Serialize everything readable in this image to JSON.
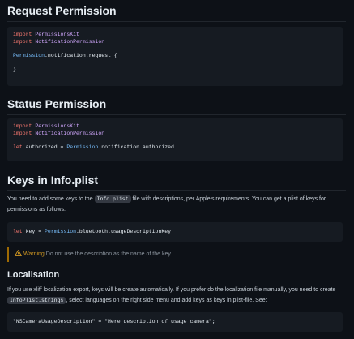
{
  "request": {
    "heading": "Request Permission",
    "import_kw": "import",
    "module1": "PermissionsKit",
    "module2": "NotificationPermission",
    "call": "Permission",
    "call_rest": ".notification.request {",
    "close_brace": "}"
  },
  "status": {
    "heading": "Status Permission",
    "import_kw": "import",
    "module1": "PermissionsKit",
    "module2": "NotificationPermission",
    "let_kw": "let",
    "var_name": "authorized",
    "assign": " = ",
    "call": "Permission",
    "call_rest": ".notification.authorized"
  },
  "keys": {
    "heading": "Keys in Info.plist",
    "para_before": "You need to add some keys to the ",
    "inline_code": "Info.plist",
    "para_after": " file with descriptions, per Apple's requirements. You can get a plist of keys for permissions as follows:",
    "code_let": "let",
    "code_var": "key",
    "code_assign": " = ",
    "code_call": "Permission",
    "code_rest": ".bluetooth.usageDescriptionKey",
    "warning_title": "Warning",
    "warning_text": " Do not use the description as the name of the key."
  },
  "localisation": {
    "heading": "Localisation",
    "para_before": "If you use xliff localization export, keys will be create automatically. If you prefer do the localization file manually, you need to create ",
    "inline_code": "InfoPlist.strings",
    "para_after": ", select languages on the right side menu and add keys as keys in plist-file. See:",
    "code_key": "\"NSCameraUsageDescription\"",
    "code_eq": " = ",
    "code_value": "\"Here description of usage camera\"",
    "code_end": ";"
  },
  "colors": {
    "background": "#0d1117",
    "code_background": "#161b22",
    "keyword": "#ff7b72",
    "module": "#d2a8ff",
    "warning": "#d29922"
  },
  "icons": {
    "warning": "warning-triangle-icon"
  }
}
